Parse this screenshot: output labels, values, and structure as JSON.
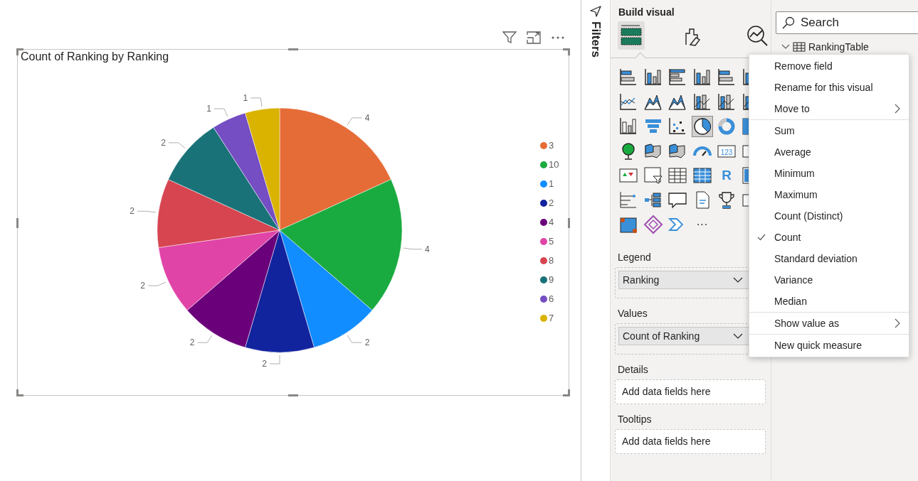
{
  "chart": {
    "chart_data": {
      "type": "pie",
      "title": "Count of Ranking by Ranking",
      "categories": [
        "3",
        "10",
        "1",
        "2",
        "4",
        "5",
        "8",
        "9",
        "6",
        "7"
      ],
      "values": [
        4,
        4,
        2,
        2,
        2,
        2,
        2,
        2,
        1,
        1
      ],
      "colors": [
        "#e66c37",
        "#1aab40",
        "#118dff",
        "#12239e",
        "#6b007b",
        "#e044a7",
        "#d64550",
        "#197278",
        "#744ec2",
        "#d9b300"
      ],
      "data_labels": true
    }
  },
  "filters_pane": {
    "title": "Filters"
  },
  "build_pane": {
    "title": "Build visual",
    "tabs": [
      {
        "kind": "build",
        "selected": true
      },
      {
        "kind": "format",
        "selected": false
      },
      {
        "kind": "analytics",
        "selected": false
      }
    ],
    "visuals": [
      {
        "kind": "stacked-bar",
        "selected": false
      },
      {
        "kind": "stacked-column",
        "selected": false
      },
      {
        "kind": "clustered-bar",
        "selected": false
      },
      {
        "kind": "clustered-column",
        "selected": false
      },
      {
        "kind": "stacked-bar",
        "selected": false
      },
      {
        "kind": "stacked-column",
        "selected": false
      },
      {
        "kind": "line",
        "selected": false
      },
      {
        "kind": "area",
        "selected": false
      },
      {
        "kind": "area",
        "selected": false
      },
      {
        "kind": "line-column",
        "selected": false
      },
      {
        "kind": "line-column",
        "selected": false
      },
      {
        "kind": "line-column",
        "selected": false
      },
      {
        "kind": "waterfall",
        "selected": false
      },
      {
        "kind": "funnel",
        "selected": false
      },
      {
        "kind": "scatter",
        "selected": false
      },
      {
        "kind": "pie",
        "selected": true
      },
      {
        "kind": "donut",
        "selected": false
      },
      {
        "kind": "treemap",
        "selected": false
      },
      {
        "kind": "globe",
        "selected": false
      },
      {
        "kind": "map",
        "selected": false
      },
      {
        "kind": "map",
        "selected": false
      },
      {
        "kind": "gauge",
        "selected": false
      },
      {
        "kind": "card",
        "label": "123",
        "selected": false
      },
      {
        "kind": "card",
        "selected": false
      },
      {
        "kind": "kpi",
        "selected": false
      },
      {
        "kind": "slicer",
        "selected": false
      },
      {
        "kind": "table",
        "selected": false
      },
      {
        "kind": "matrix",
        "selected": false
      },
      {
        "kind": "letter",
        "label": "R",
        "selected": false
      },
      {
        "kind": "cut",
        "selected": false
      },
      {
        "kind": "tree",
        "selected": false
      },
      {
        "kind": "decomposition",
        "selected": false
      },
      {
        "kind": "speech",
        "selected": false
      },
      {
        "kind": "document",
        "selected": false
      },
      {
        "kind": "trophy",
        "selected": false
      },
      {
        "kind": "card",
        "selected": false
      },
      {
        "kind": "apps",
        "selected": false
      },
      {
        "kind": "diamond",
        "selected": false
      },
      {
        "kind": "automate",
        "selected": false
      },
      {
        "kind": "more",
        "label": "···",
        "selected": false
      }
    ],
    "wells": [
      {
        "label": "Legend",
        "field": "Ranking"
      },
      {
        "label": "Values",
        "field": "Count of Ranking"
      },
      {
        "label": "Details",
        "placeholder": "Add data fields here"
      },
      {
        "label": "Tooltips",
        "placeholder": "Add data fields here"
      }
    ]
  },
  "fields_pane": {
    "search": {
      "placeholder": "Search"
    },
    "table": "RankingTable"
  },
  "context_menu": [
    {
      "kind": "item",
      "label": "Remove field",
      "checked": false
    },
    {
      "kind": "item",
      "label": "Rename for this visual",
      "checked": false
    },
    {
      "kind": "submenu",
      "label": "Move to",
      "checked": false
    },
    {
      "kind": "separator"
    },
    {
      "kind": "item",
      "label": "Sum",
      "checked": false
    },
    {
      "kind": "item",
      "label": "Average",
      "checked": false
    },
    {
      "kind": "item",
      "label": "Minimum",
      "checked": false
    },
    {
      "kind": "item",
      "label": "Maximum",
      "checked": false
    },
    {
      "kind": "item",
      "label": "Count (Distinct)",
      "checked": false
    },
    {
      "kind": "item",
      "label": "Count",
      "checked": true
    },
    {
      "kind": "item",
      "label": "Standard deviation",
      "checked": false
    },
    {
      "kind": "item",
      "label": "Variance",
      "checked": false
    },
    {
      "kind": "item",
      "label": "Median",
      "checked": false
    },
    {
      "kind": "separator"
    },
    {
      "kind": "submenu",
      "label": "Show value as",
      "checked": false
    },
    {
      "kind": "separator"
    },
    {
      "kind": "item",
      "label": "New quick measure",
      "checked": false
    }
  ]
}
